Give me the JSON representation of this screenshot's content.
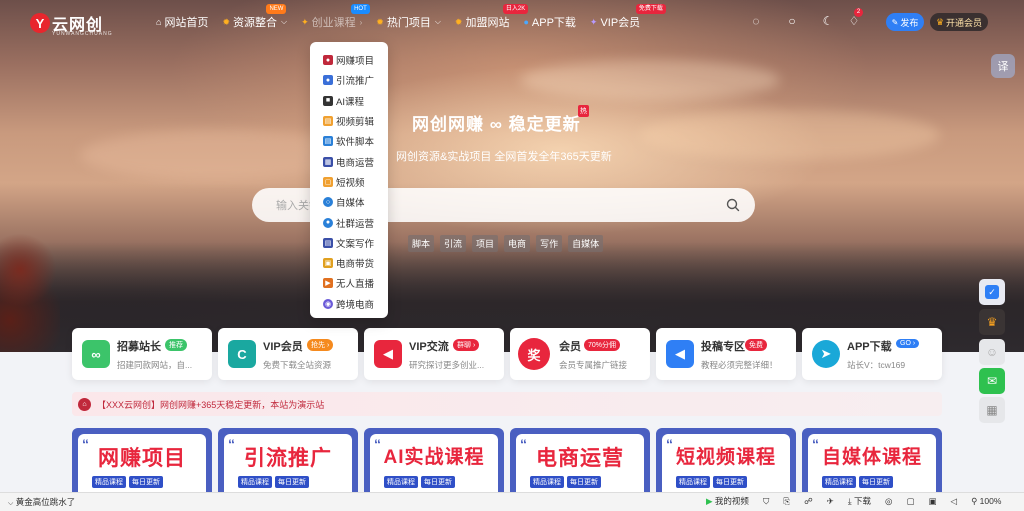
{
  "header": {
    "logo_letter": "Y",
    "logo_text": "云网创",
    "logo_sub": "YUNWANGCHUANG",
    "nav": [
      {
        "icon": "⌂",
        "label": "网站首页",
        "tag": "",
        "caret": false
      },
      {
        "icon": "✹",
        "label": "资源整合",
        "tag": "NEW",
        "caret": true
      },
      {
        "icon": "✦",
        "label": "创业课程",
        "tag": "HOT",
        "caret": true
      },
      {
        "icon": "✹",
        "label": "热门项目",
        "tag": "",
        "caret": true
      },
      {
        "icon": "✹",
        "label": "加盟网站",
        "tag": "日入2K",
        "caret": false
      },
      {
        "icon": "●",
        "label": "APP下载",
        "tag": "",
        "caret": false
      },
      {
        "icon": "✦",
        "label": "VIP会员",
        "tag": "免费下载",
        "caret": false
      }
    ],
    "bell_count": "2",
    "publish_label": "发布",
    "vip_label": "开通会员"
  },
  "dropdown": {
    "items": [
      {
        "label": "网赚项目",
        "color": "#c0283b"
      },
      {
        "label": "引流推广",
        "color": "#3a6fd8"
      },
      {
        "label": "AI课程",
        "color": "#333333"
      },
      {
        "label": "视频剪辑",
        "color": "#f0a030"
      },
      {
        "label": "软件脚本",
        "color": "#2a80d8"
      },
      {
        "label": "电商运营",
        "color": "#3a4fa8"
      },
      {
        "label": "短视频",
        "color": "#f0a030"
      },
      {
        "label": "自媒体",
        "color": "#2a80d8"
      },
      {
        "label": "社群运营",
        "color": "#2a80d8"
      },
      {
        "label": "文案写作",
        "color": "#3a4fa8"
      },
      {
        "label": "电商带货",
        "color": "#e0a020"
      },
      {
        "label": "无人直播",
        "color": "#e07020"
      },
      {
        "label": "跨境电商",
        "color": "#6a5ad8"
      }
    ]
  },
  "hero": {
    "title": "网创网赚 ∞ 稳定更新",
    "hot_tag": "热",
    "subtitle": "网创资源&实战项目 全网首发全年365天更新",
    "search_placeholder": "输入关键",
    "keywords": [
      "脚本",
      "引流",
      "项目",
      "电商",
      "写作",
      "自媒体"
    ]
  },
  "features": [
    {
      "title": "招募站长",
      "badge": "推荐",
      "badge_color": "#3cc46a",
      "desc": "招建同款网站，自...",
      "icon": "∞",
      "icon_color": "#3cc46a"
    },
    {
      "title": "VIP会员",
      "badge": "抢先 ›",
      "badge_color": "#f58a1e",
      "desc": "免费下载全站资源",
      "icon": "C",
      "icon_color": "#1aa8a0"
    },
    {
      "title": "VIP交流",
      "badge": "群聊 ›",
      "badge_color": "#e8263d",
      "desc": "研究探讨更多创业...",
      "icon": "◀",
      "icon_color": "#e8263d"
    },
    {
      "title": "会员",
      "badge": "70%分佣",
      "badge_color": "#e8263d",
      "desc": "会员专属推广链接",
      "icon": "奖",
      "icon_color": "#e8263d"
    },
    {
      "title": "投稿专区",
      "badge": "免费",
      "badge_color": "#e8263d",
      "desc": "教程必须完整详细！",
      "icon": "◀",
      "icon_color": "#2f7ff5"
    },
    {
      "title": "APP下载",
      "badge": "GO ›",
      "badge_color": "#2f7ff5",
      "desc": "站长V：tcw169",
      "icon": "➤",
      "icon_color": "#1aa8d8"
    }
  ],
  "notice": "【XXX云网创】网创网赚+365天稳定更新，本站为演示站",
  "banners": [
    {
      "title": "网赚项目",
      "tags": [
        "精品课程",
        "每日更新"
      ]
    },
    {
      "title": "引流推广",
      "tags": [
        "精品课程",
        "每日更新"
      ]
    },
    {
      "title": "AI实战课程",
      "tags": [
        "精品课程",
        "每日更新"
      ]
    },
    {
      "title": "电商运营",
      "tags": [
        "精品课程",
        "每日更新"
      ]
    },
    {
      "title": "短视频课程",
      "tags": [
        "精品课程",
        "每日更新"
      ]
    },
    {
      "title": "自媒体课程",
      "tags": [
        "精品课程",
        "每日更新"
      ]
    }
  ],
  "side": {
    "top_label": "译"
  },
  "statusbar": {
    "left": "黄金高位跳水了",
    "video": "我的视频",
    "download": "下载",
    "zoom": "100%"
  }
}
